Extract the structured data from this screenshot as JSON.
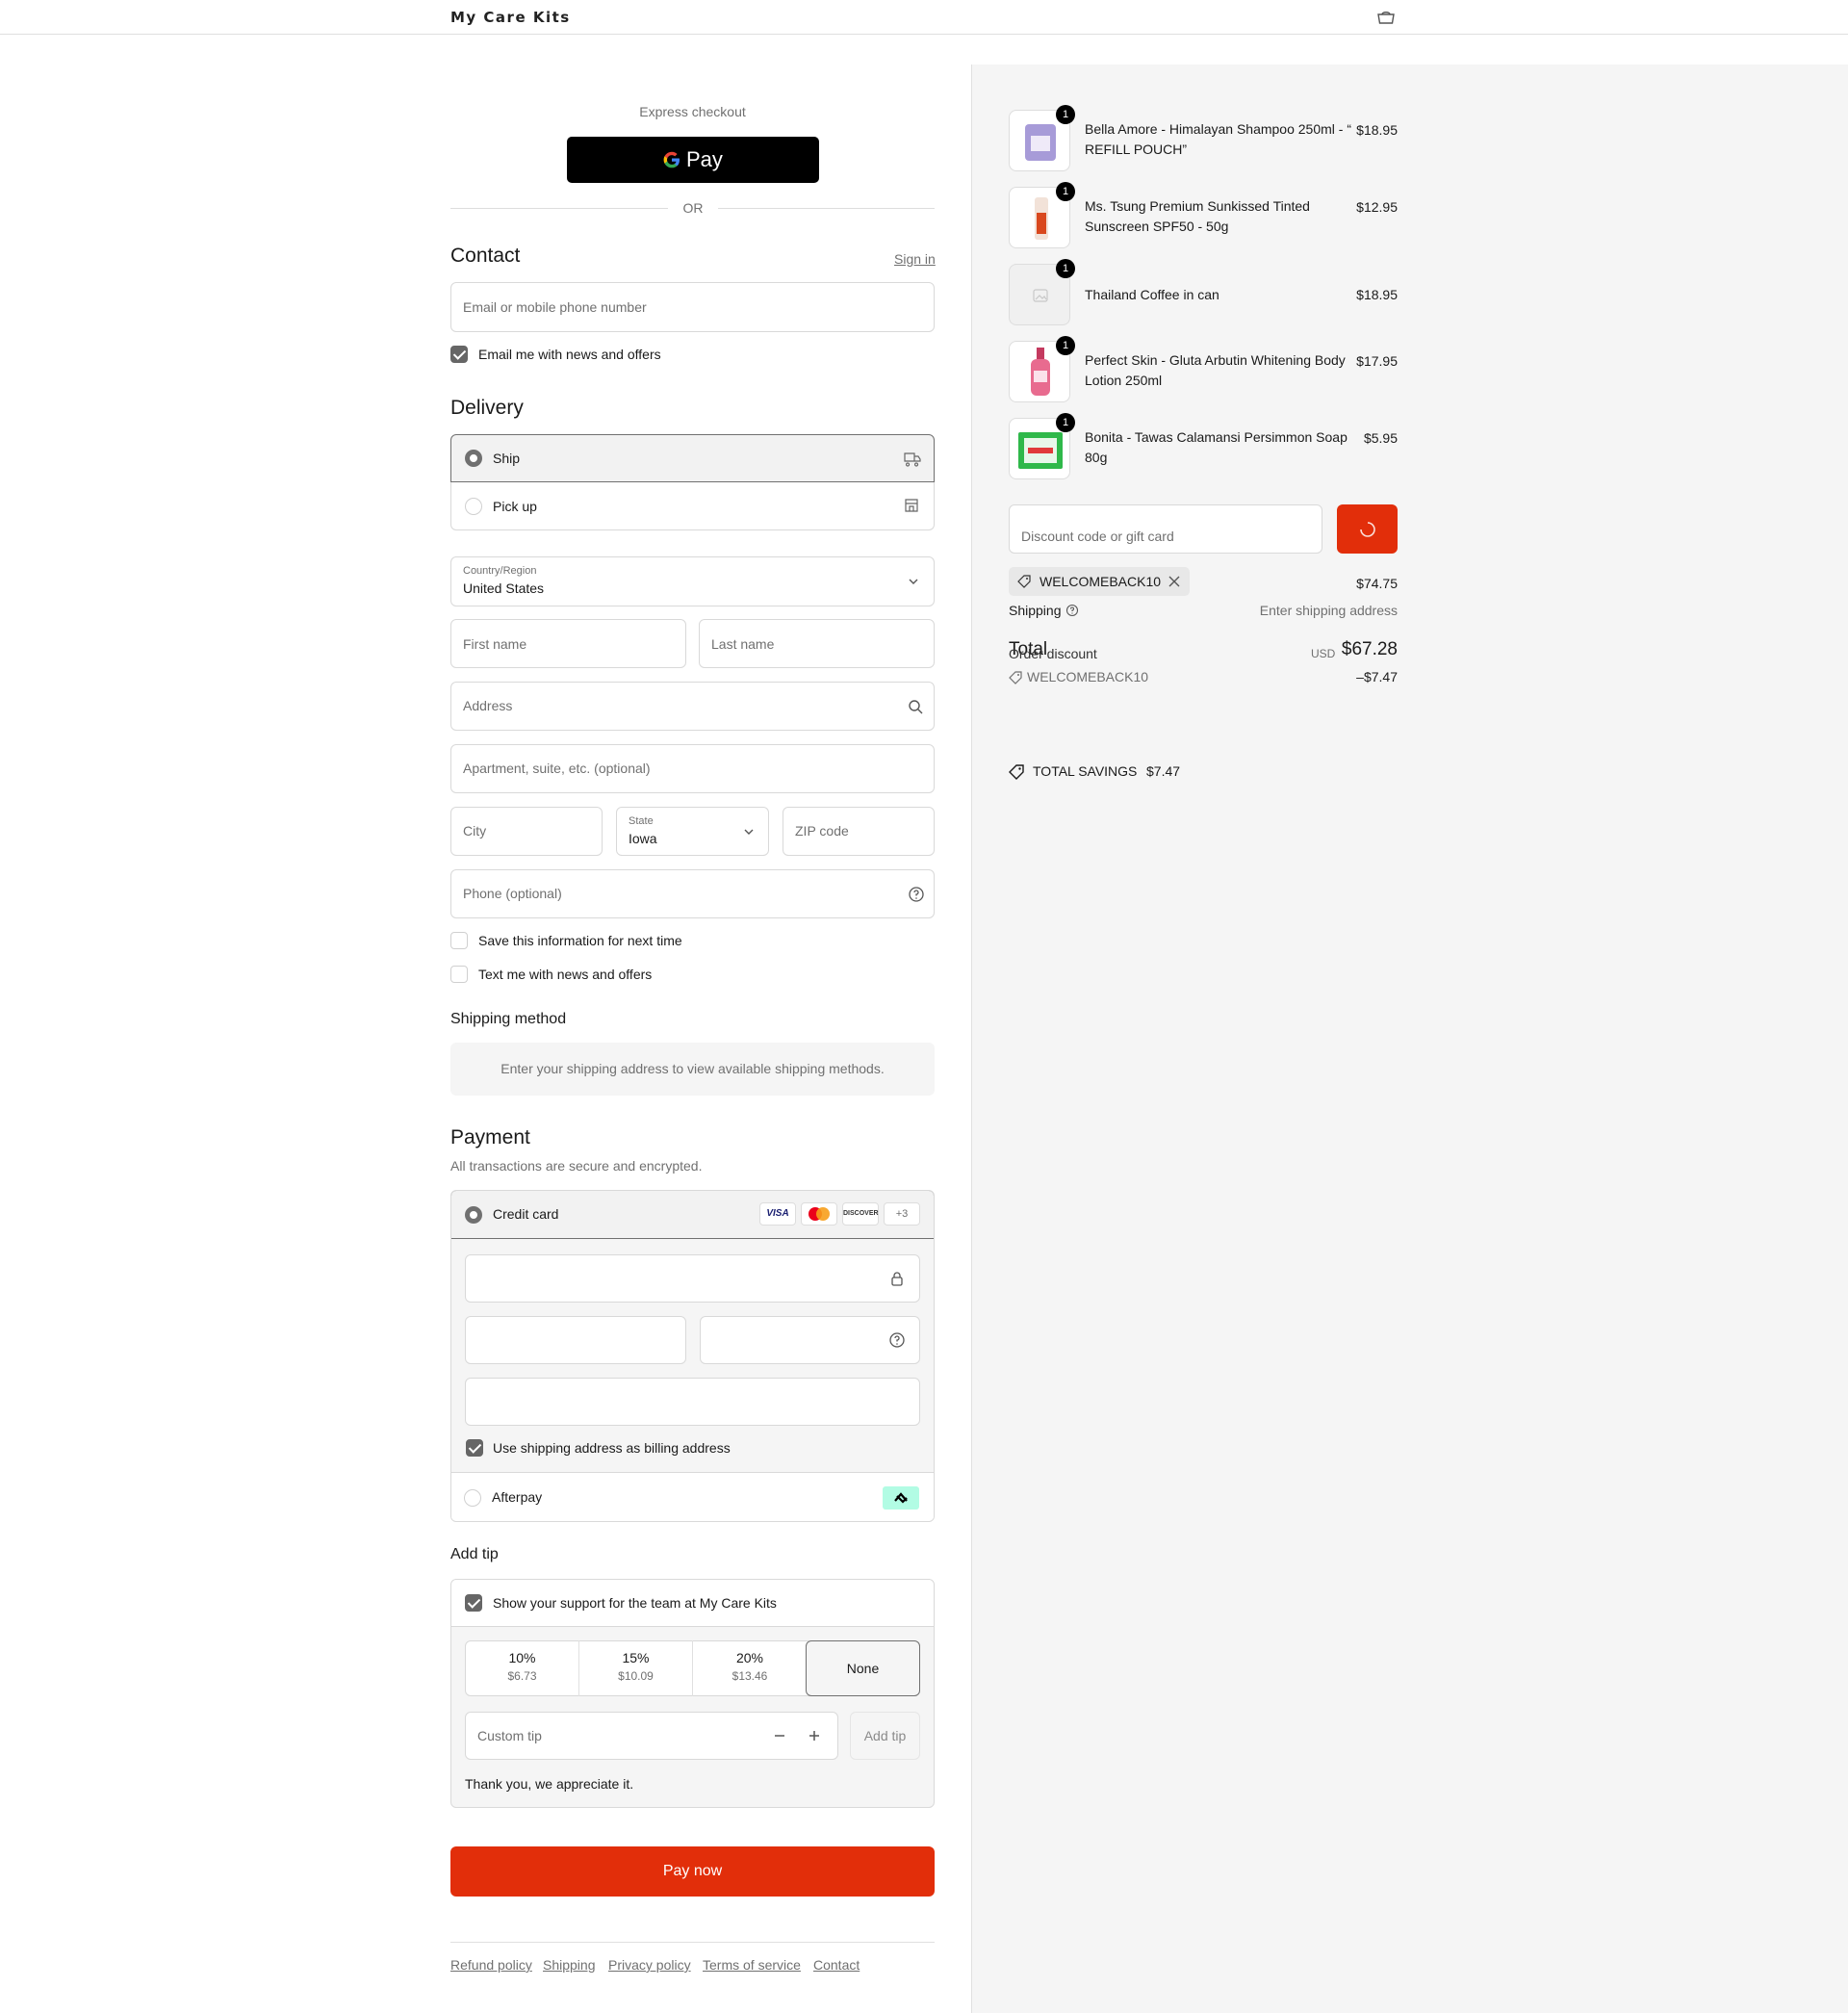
{
  "header": {
    "store_name": "My Care Kits"
  },
  "express": {
    "title": "Express checkout",
    "gpay_label": "Pay",
    "or": "OR"
  },
  "contact": {
    "title": "Contact",
    "sign_in": "Sign in",
    "email_placeholder": "Email or mobile phone number",
    "email_news": "Email me with news and offers",
    "email_news_checked": true
  },
  "delivery": {
    "title": "Delivery",
    "options": [
      {
        "label": "Ship",
        "selected": true
      },
      {
        "label": "Pick up",
        "selected": false
      }
    ],
    "country_label": "Country/Region",
    "country_value": "United States",
    "first_name": "First name",
    "last_name": "Last name",
    "address": "Address",
    "apartment": "Apartment, suite, etc. (optional)",
    "city": "City",
    "state_label": "State",
    "state_value": "Iowa",
    "zip": "ZIP code",
    "phone": "Phone (optional)",
    "save_info": "Save this information for next time",
    "text_news": "Text me with news and offers"
  },
  "shipping_method": {
    "title": "Shipping method",
    "notice": "Enter your shipping address to view available shipping methods."
  },
  "payment": {
    "title": "Payment",
    "subtitle": "All transactions are secure and encrypted.",
    "credit_card": "Credit card",
    "card_logos": [
      "VISA",
      "DISCOVER"
    ],
    "more_cards": "+3",
    "billing_same": "Use shipping address as billing address",
    "afterpay": "Afterpay"
  },
  "tip": {
    "title": "Add tip",
    "support": "Show your support for the team at My Care Kits",
    "options": [
      {
        "percent": "10%",
        "amount": "$6.73"
      },
      {
        "percent": "15%",
        "amount": "$10.09"
      },
      {
        "percent": "20%",
        "amount": "$13.46"
      }
    ],
    "none": "None",
    "custom_placeholder": "Custom tip",
    "add_tip": "Add tip",
    "thanks": "Thank you, we appreciate it."
  },
  "pay_now": "Pay now",
  "footer_links": [
    "Refund policy",
    "Shipping",
    "Privacy policy",
    "Terms of service",
    "Contact"
  ],
  "summary": {
    "items": [
      {
        "name": "Bella Amore - Himalayan Shampoo 250ml - “ REFILL POUCH”",
        "price": "$18.95",
        "qty": "1"
      },
      {
        "name": "Ms. Tsung Premium Sunkissed Tinted Sunscreen SPF50 - 50g",
        "price": "$12.95",
        "qty": "1"
      },
      {
        "name": "Thailand Coffee in can",
        "price": "$18.95",
        "qty": "1"
      },
      {
        "name": "Perfect Skin - Gluta Arbutin Whitening Body Lotion 250ml",
        "price": "$17.95",
        "qty": "1"
      },
      {
        "name": "Bonita - Tawas Calamansi Persimmon Soap 80g",
        "price": "$5.95",
        "qty": "1"
      }
    ],
    "discount_placeholder": "Discount code or gift card",
    "applied_code": "WELCOMEBACK10",
    "subtotal": "$74.75",
    "shipping_label": "Shipping",
    "shipping_value": "Enter shipping address",
    "total_label": "Total",
    "order_discount_label": "Order discount",
    "currency": "USD",
    "total_value": "$67.28",
    "discount_code": "WELCOMEBACK10",
    "discount_value": "–$7.47",
    "total_savings_label": "TOTAL SAVINGS",
    "total_savings_value": "$7.47"
  },
  "colors": {
    "accent": "#e22e0a",
    "gpay_bg": "#000000",
    "afterpay": "#b2fce4"
  }
}
